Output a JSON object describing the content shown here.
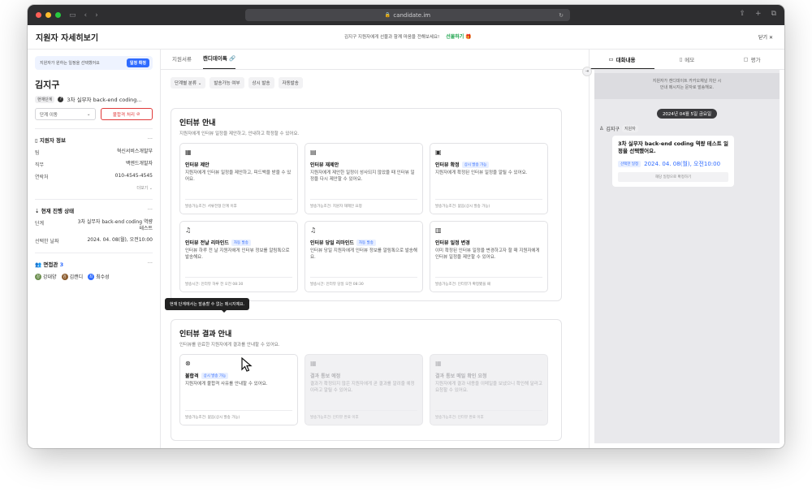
{
  "browser": {
    "url": "candidate.im",
    "colors": {
      "close": "#ff5f57",
      "min": "#febc2e",
      "max": "#28c840"
    }
  },
  "header": {
    "title": "지원자 자세히보기",
    "message": "김지구 지원자에게 선물과 함께 마음을 전해보세요!",
    "gift_label": "선물하기",
    "close_label": "닫기"
  },
  "left": {
    "confirm_notice": "지원자가 원하는 일정을 선택했어요",
    "confirm_button": "일정 확정",
    "candidate_name": "김지구",
    "stage_tag": "현재단계",
    "stage_text": "3차 실무자 back-end coding...",
    "move_stage": "단계 이동",
    "reject_button": "불합격 처리",
    "info_section": {
      "title": "지원자 정보",
      "more": "···",
      "rows": [
        {
          "k": "팀",
          "v": "혁신서비스개발부"
        },
        {
          "k": "직무",
          "v": "백엔드개발자"
        },
        {
          "k": "연락처",
          "v": "010-4545-4545"
        }
      ],
      "fold": "더보기 ⌄"
    },
    "progress_section": {
      "title": "현재 진행 상태",
      "more": "···",
      "rows": [
        {
          "k": "단계",
          "v": "3차 실무자 back-end coding 역량 테스트"
        },
        {
          "k": "선택한 날짜",
          "v": "2024. 04. 08(월), 오전10:00"
        }
      ]
    },
    "interviewer_section": {
      "title": "면접관",
      "count": "3",
      "more": "···",
      "people": [
        {
          "name": "강대양",
          "initial": "강",
          "color": "#6b8e4e"
        },
        {
          "name": "김캔디",
          "initial": "김",
          "color": "#8a5a2b"
        },
        {
          "name": "최수성",
          "initial": "최",
          "color": "#2f6bff"
        }
      ]
    }
  },
  "center": {
    "tabs": [
      "지원서류",
      "캔디데이톡"
    ],
    "filters": [
      "단계별 분류 ⌄",
      "발송가능 여부",
      "상시 발송",
      "자동발송"
    ],
    "interview_guide": {
      "title": "인터뷰 안내",
      "subtitle": "지원자에게 인터뷰 일정을 제안하고, 안내하고 확정할 수 있어요.",
      "cards": [
        {
          "icon": "calendar-icon",
          "glyph": "▦",
          "title": "인터뷰 제안",
          "badge": "",
          "desc": "지원자에게 인터뷰 일정을 제안하고, 피드백을 받을 수 있어요.",
          "cond": "발송가능조건: 서류전형 단계 이후"
        },
        {
          "icon": "calendar-refresh-icon",
          "glyph": "▤",
          "title": "인터뷰 재제안",
          "badge": "",
          "desc": "지원자에게 제안한 일정이 성사되지 않았을 때 인터뷰 일정을 다시 제안할 수 있어요.",
          "cond": "발송가능조건: 지원자 재제안 요청"
        },
        {
          "icon": "calendar-check-icon",
          "glyph": "▣",
          "title": "인터뷰 확정",
          "badge": "상시 발송 가능",
          "desc": "지원자에게 확정된 인터뷰 일정을 알릴 수 있어요.",
          "cond": "발송가능조건: 없음(상시 발송 가능)"
        },
        {
          "icon": "bell-icon",
          "glyph": "♫",
          "title": "인터뷰 전날 리마인드",
          "badge": "자동 발송",
          "desc": "인터뷰 하루 전 날 지원자에게 인터뷰 정보를 알림톡으로 발송해요.",
          "cond": "발송시간: 인터뷰 하루 전 오전 08:30"
        },
        {
          "icon": "bell-icon",
          "glyph": "♫",
          "title": "인터뷰 당일 리마인드",
          "badge": "자동 발송",
          "desc": "인터뷰 당일 지원자에게 인터뷰 정보를 알림톡으로 발송해요.",
          "cond": "발송시간: 인터뷰 당일 오전 08:30"
        },
        {
          "icon": "calendar-edit-icon",
          "glyph": "▥",
          "title": "인터뷰 일정 변경",
          "badge": "",
          "desc": "이미 확정된 인터뷰 일정을 변경하고자 할 때 지원자에게 인터뷰 일정을 제안할 수 있어요.",
          "cond": "발송가능조건: 인터뷰가 확정됐을 때"
        }
      ]
    },
    "result_guide": {
      "title": "인터뷰 결과 안내",
      "subtitle": "인터뷰를 완료한 지원자에게 결과를 안내할 수 있어요.",
      "cards": [
        {
          "icon": "x-circle-icon",
          "glyph": "⊗",
          "title": "불합격",
          "badge": "상시 발송 가능",
          "desc": "지원자에게 불합격 사유를 안내할 수 있어요.",
          "cond": "발송가능조건: 없음(상시 발송 가능)",
          "disabled": false
        },
        {
          "icon": "calendar-icon",
          "glyph": "▦",
          "title": "결과 통보 예정",
          "badge": "",
          "desc": "결과가 확정되지 않은 지원자에게 곧 결과를 알려줄 예정이라고 알릴 수 있어요.",
          "cond": "발송가능조건: 인터뷰 완료 이후",
          "disabled": true
        },
        {
          "icon": "calendar-icon",
          "glyph": "▦",
          "title": "결과 통보 메일 확인 요청",
          "badge": "",
          "desc": "지원자에게 결과 내용을 이메일을 보냈으니 확인해 달라고 요청할 수 있어요.",
          "cond": "발송가능조건: 인터뷰 완료 이후",
          "disabled": true
        }
      ]
    },
    "tooltip": "현재 단계에서는 발송할 수 없는 메시지예요."
  },
  "right": {
    "tabs": [
      {
        "label": "대화내용",
        "icon": "chat-icon",
        "glyph": "▭"
      },
      {
        "label": "메모",
        "icon": "memo-icon",
        "glyph": "▯"
      },
      {
        "label": "평가",
        "icon": "clipboard-icon",
        "glyph": "▢"
      }
    ],
    "notice": "지원자가 캔디데이트 카카오채널 차단 시\n안내 메시지는 문자로 발송해요.",
    "date": "2024년 04월 5일 금요일",
    "sender": "김지구",
    "sender_tag": "지원자",
    "bubble_title": "3차 실무자 back-end coding 역량 테스트 일정을 선택했어요.",
    "selected_label": "선택한 일정",
    "selected_value": "2024. 04. 08(월), 오전10:00",
    "confirm_button": "해당 일정으로 확정하기"
  }
}
